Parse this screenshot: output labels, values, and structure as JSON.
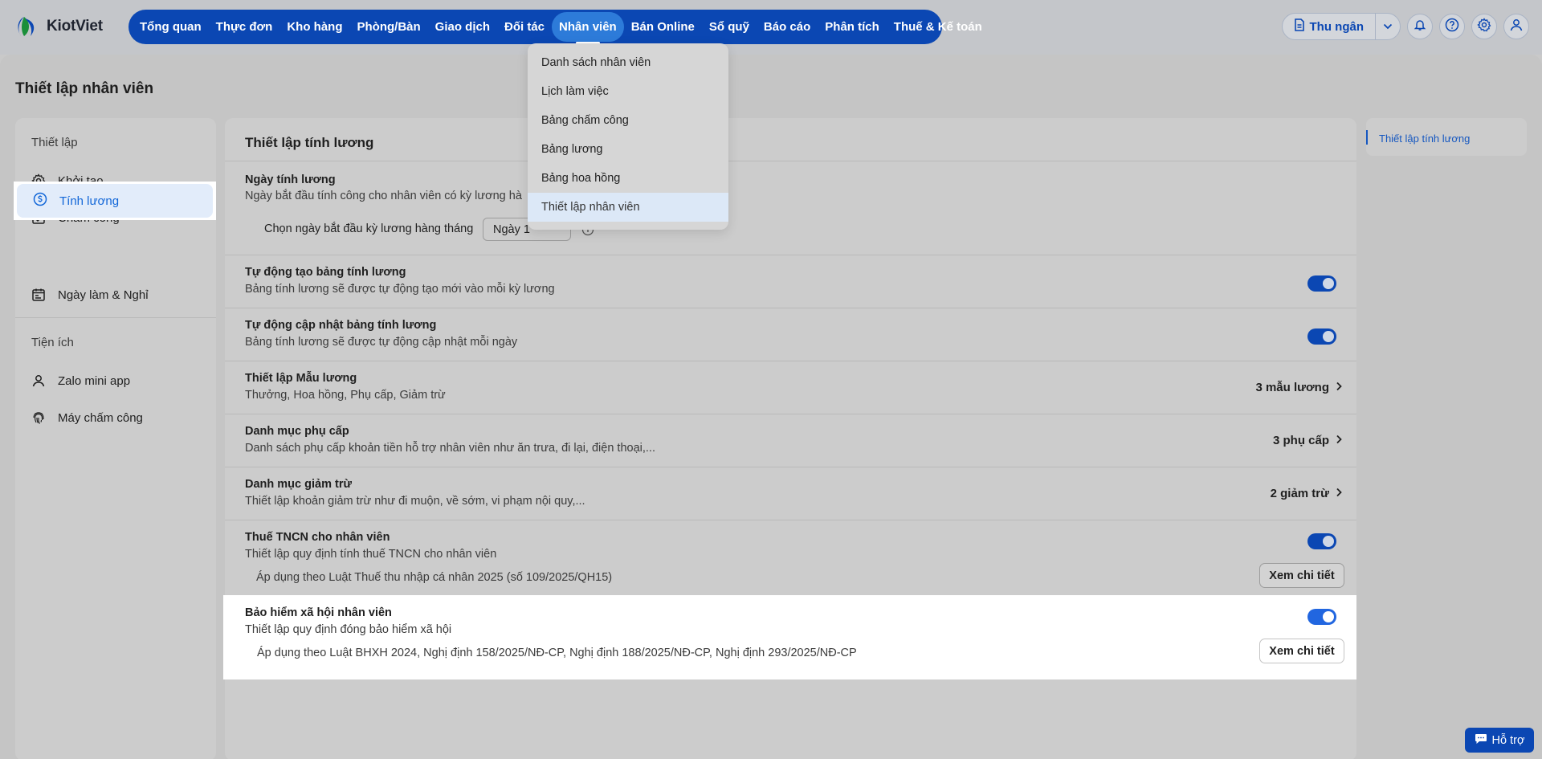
{
  "brand": {
    "name": "KiotViet"
  },
  "nav": {
    "items": [
      {
        "label": "Tổng quan"
      },
      {
        "label": "Thực đơn"
      },
      {
        "label": "Kho hàng"
      },
      {
        "label": "Phòng/Bàn"
      },
      {
        "label": "Giao dịch"
      },
      {
        "label": "Đối tác"
      },
      {
        "label": "Nhân viên",
        "active": true
      },
      {
        "label": "Bán Online"
      },
      {
        "label": "Sổ quỹ"
      },
      {
        "label": "Báo cáo"
      },
      {
        "label": "Phân tích"
      },
      {
        "label": "Thuế & Kế toán"
      }
    ]
  },
  "tools": {
    "cashier_label": "Thu ngân"
  },
  "dropdown": {
    "items": [
      {
        "label": "Danh sách nhân viên"
      },
      {
        "label": "Lịch làm việc"
      },
      {
        "label": "Bảng chấm công"
      },
      {
        "label": "Bảng lương"
      },
      {
        "label": "Bảng hoa hồng"
      },
      {
        "label": "Thiết lập nhân viên",
        "active": true
      }
    ]
  },
  "page": {
    "title": "Thiết lập nhân viên"
  },
  "sidebar": {
    "section1": "Thiết lập",
    "items": [
      {
        "label": "Khởi tạo",
        "icon": "gear-icon"
      },
      {
        "label": "Chấm công",
        "icon": "calendar-check-icon"
      },
      {
        "label": "Tính lương",
        "icon": "dollar-circle-icon",
        "active": true
      },
      {
        "label": "Ngày làm & Nghỉ",
        "icon": "calendar-icon"
      }
    ],
    "section2": "Tiện ích",
    "items2": [
      {
        "label": "Zalo mini app",
        "icon": "user-icon"
      },
      {
        "label": "Máy chấm công",
        "icon": "fingerprint-icon"
      }
    ]
  },
  "main": {
    "title": "Thiết lập tính lương",
    "pay_day": {
      "title": "Ngày tính lương",
      "desc": "Ngày bắt đầu tính công cho nhân viên có kỳ lương hà",
      "select_label": "Chọn ngày bắt đầu kỳ lương hàng tháng",
      "select_value": "Ngày 1"
    },
    "auto_create": {
      "title": "Tự động tạo bảng tính lương",
      "desc": "Bảng tính lương sẽ được tự động tạo mới vào mỗi kỳ lương",
      "enabled": true
    },
    "auto_update": {
      "title": "Tự động cập nhật bảng tính lương",
      "desc": "Bảng tính lương sẽ được tự động cập nhật mỗi ngày",
      "enabled": true
    },
    "salary_template": {
      "title": "Thiết lập Mẫu lương",
      "desc": "Thưởng, Hoa hồng, Phụ cấp, Giảm trừ",
      "value": "3 mẫu lương"
    },
    "allowance": {
      "title": "Danh mục phụ cấp",
      "desc": "Danh sách phụ cấp khoản tiền hỗ trợ nhân viên như ăn trưa, đi lại, điện thoại,...",
      "value": "3 phụ cấp"
    },
    "deduction": {
      "title": "Danh mục giảm trừ",
      "desc": "Thiết lập khoản giảm trừ như đi muộn, về sớm, vi phạm nội quy,...",
      "value": "2 giảm trừ"
    },
    "tax": {
      "title": "Thuế TNCN cho nhân viên",
      "desc": "Thiết lập quy định tính thuế TNCN cho nhân viên",
      "note": "Áp dụng theo Luật Thuế thu nhập cá nhân 2025 (số 109/2025/QH15)",
      "button": "Xem chi tiết",
      "enabled": true
    },
    "insurance": {
      "title": "Bảo hiểm xã hội nhân viên",
      "desc": "Thiết lập quy định đóng bảo hiểm xã hội",
      "note": "Áp dụng theo Luật BHXH 2024, Nghị định 158/2025/NĐ-CP, Nghị định 188/2025/NĐ-CP, Nghị định 293/2025/NĐ-CP",
      "button": "Xem chi tiết",
      "enabled": true
    }
  },
  "anchor": {
    "link": "Thiết lập tính lương"
  },
  "help": {
    "label": "Hỗ trợ"
  }
}
